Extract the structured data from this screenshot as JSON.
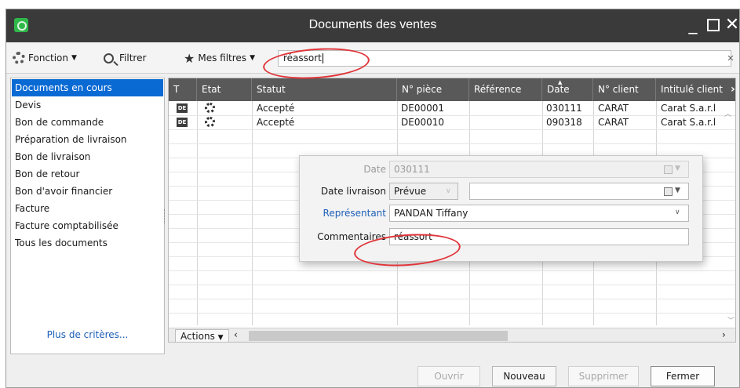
{
  "window": {
    "title": "Documents des ventes"
  },
  "toolbar": {
    "fonction_label": "Fonction",
    "filtrer_label": "Filtrer",
    "mes_filtres_label": "Mes filtres",
    "search_value": "réassort"
  },
  "sidebar": {
    "items": [
      {
        "label": "Documents en cours",
        "selected": true
      },
      {
        "label": "Devis",
        "selected": false
      },
      {
        "label": "Bon de commande",
        "selected": false
      },
      {
        "label": "Préparation de livraison",
        "selected": false
      },
      {
        "label": "Bon de livraison",
        "selected": false
      },
      {
        "label": "Bon de retour",
        "selected": false
      },
      {
        "label": "Bon d'avoir financier",
        "selected": false
      },
      {
        "label": "Facture",
        "selected": false
      },
      {
        "label": "Facture comptabilisée",
        "selected": false
      },
      {
        "label": "Tous les documents",
        "selected": false
      }
    ],
    "more_criteria": "Plus de critères..."
  },
  "grid": {
    "columns": [
      "T",
      "Etat",
      "Statut",
      "N° pièce",
      "Référence",
      "Date",
      "N° client",
      "Intitulé client"
    ],
    "rows": [
      {
        "type": "DE",
        "status": "Accepté",
        "piece": "DE00001",
        "reference": "",
        "date": "030111",
        "client": "CARAT",
        "intitule": "Carat S.a.r.l"
      },
      {
        "type": "DE",
        "status": "Accepté",
        "piece": "DE00010",
        "reference": "",
        "date": "090318",
        "client": "CARAT",
        "intitule": "Carat S.a.r.l"
      }
    ],
    "actions_label": "Actions"
  },
  "popup": {
    "date_label": "Date",
    "date_value": "030111",
    "date_livraison_label": "Date livraison",
    "date_livraison_value": "Prévue",
    "representant_label": "Représentant",
    "representant_value": "PANDAN Tiffany",
    "commentaires_label": "Commentaires",
    "commentaires_value": "réassort"
  },
  "buttons": {
    "ouvrir": "Ouvrir",
    "nouveau": "Nouveau",
    "supprimer": "Supprimer",
    "fermer": "Fermer"
  },
  "colors": {
    "titlebar": "#3a3a3a",
    "selection": "#0a6ad4",
    "grid_header": "#595959",
    "annotation": "#e0353a",
    "link": "#1d5fb8"
  }
}
